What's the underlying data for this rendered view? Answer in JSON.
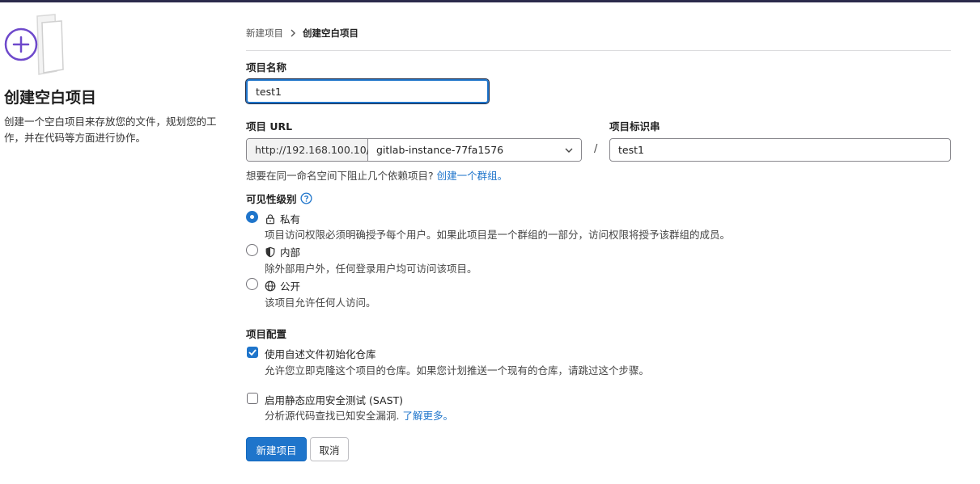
{
  "breadcrumb": {
    "parent": "新建项目",
    "current": "创建空白项目"
  },
  "left": {
    "title": "创建空白项目",
    "description": "创建一个空白项目来存放您的文件，规划您的工作，并在代码等方面进行协作。"
  },
  "form": {
    "name_label": "项目名称",
    "name_value": "test1",
    "url_label": "项目 URL",
    "url_prefix": "http://192.168.100.10/",
    "namespace": "gitlab-instance-77fa1576",
    "slash": "/",
    "slug_label": "项目标识串",
    "slug_value": "test1",
    "helper_text": "想要在同一命名空间下阻止几个依赖项目?",
    "helper_link": "创建一个群组。"
  },
  "visibility": {
    "label": "可见性级别",
    "options": [
      {
        "label": "私有",
        "icon": "lock-icon",
        "description": "项目访问权限必须明确授予每个用户。如果此项目是一个群组的一部分，访问权限将授予该群组的成员。",
        "selected": true
      },
      {
        "label": "内部",
        "icon": "shield-icon",
        "description": "除外部用户外，任何登录用户均可访问该项目。",
        "selected": false
      },
      {
        "label": "公开",
        "icon": "globe-icon",
        "description": "该项目允许任何人访问。",
        "selected": false
      }
    ]
  },
  "config": {
    "label": "项目配置",
    "readme_label": "使用自述文件初始化仓库",
    "readme_desc": "允许您立即克隆这个项目的仓库。如果您计划推送一个现有的仓库，请跳过这个步骤。",
    "readme_checked": true,
    "sast_label": "启用静态应用安全测试 (SAST)",
    "sast_desc": "分析源代码查找已知安全漏洞.",
    "sast_link": "了解更多。",
    "sast_checked": false
  },
  "buttons": {
    "create": "新建项目",
    "cancel": "取消"
  },
  "colors": {
    "accent": "#1f75cb",
    "illustration": "#6e49cb"
  }
}
